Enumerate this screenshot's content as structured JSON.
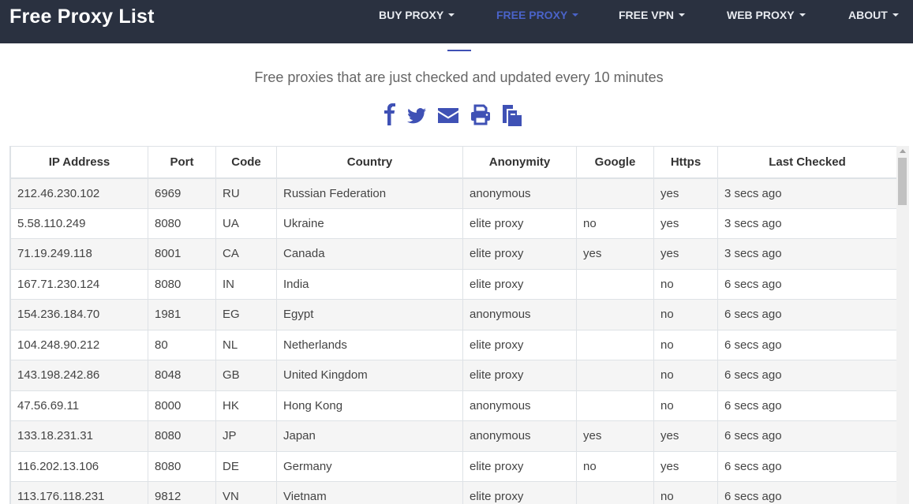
{
  "brand": {
    "title": "Free Proxy List"
  },
  "nav": [
    {
      "label": "BUY PROXY",
      "active": false
    },
    {
      "label": "FREE PROXY",
      "active": true
    },
    {
      "label": "FREE VPN",
      "active": false
    },
    {
      "label": "WEB PROXY",
      "active": false
    },
    {
      "label": "ABOUT",
      "active": false
    }
  ],
  "subtitle": "Free proxies that are just checked and updated every 10 minutes",
  "share_icons": [
    "facebook-icon",
    "twitter-icon",
    "email-icon",
    "print-icon",
    "copy-icon"
  ],
  "colors": {
    "navbar": "#2a3140",
    "accent": "#3f51b5",
    "nav_active": "#4a63c9"
  },
  "table": {
    "headers": [
      "IP Address",
      "Port",
      "Code",
      "Country",
      "Anonymity",
      "Google",
      "Https",
      "Last Checked"
    ],
    "rows": [
      [
        "212.46.230.102",
        "6969",
        "RU",
        "Russian Federation",
        "anonymous",
        "",
        "yes",
        "3 secs ago"
      ],
      [
        "5.58.110.249",
        "8080",
        "UA",
        "Ukraine",
        "elite proxy",
        "no",
        "yes",
        "3 secs ago"
      ],
      [
        "71.19.249.118",
        "8001",
        "CA",
        "Canada",
        "elite proxy",
        "yes",
        "yes",
        "3 secs ago"
      ],
      [
        "167.71.230.124",
        "8080",
        "IN",
        "India",
        "elite proxy",
        "",
        "no",
        "6 secs ago"
      ],
      [
        "154.236.184.70",
        "1981",
        "EG",
        "Egypt",
        "anonymous",
        "",
        "no",
        "6 secs ago"
      ],
      [
        "104.248.90.212",
        "80",
        "NL",
        "Netherlands",
        "elite proxy",
        "",
        "no",
        "6 secs ago"
      ],
      [
        "143.198.242.86",
        "8048",
        "GB",
        "United Kingdom",
        "elite proxy",
        "",
        "no",
        "6 secs ago"
      ],
      [
        "47.56.69.11",
        "8000",
        "HK",
        "Hong Kong",
        "anonymous",
        "",
        "no",
        "6 secs ago"
      ],
      [
        "133.18.231.31",
        "8080",
        "JP",
        "Japan",
        "anonymous",
        "yes",
        "yes",
        "6 secs ago"
      ],
      [
        "116.202.13.106",
        "8080",
        "DE",
        "Germany",
        "elite proxy",
        "no",
        "yes",
        "6 secs ago"
      ],
      [
        "113.176.118.231",
        "9812",
        "VN",
        "Vietnam",
        "elite proxy",
        "",
        "no",
        "6 secs ago"
      ]
    ]
  }
}
